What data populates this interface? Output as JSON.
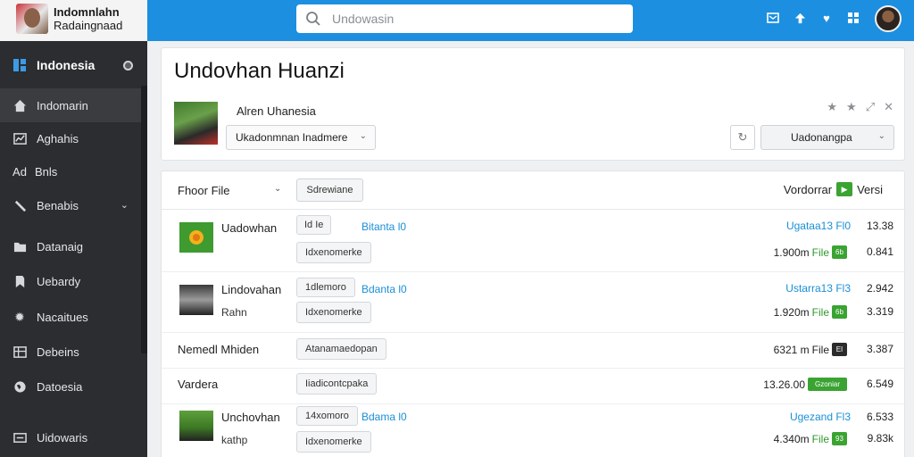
{
  "brand": {
    "line1": "Indomnlahn",
    "line2": "Radaingnaad"
  },
  "sidebar": {
    "header": "Indonesia",
    "items": [
      {
        "label": "Indomarin",
        "icon": "home-icon"
      },
      {
        "label": "Aghahis",
        "icon": "chart-icon"
      },
      {
        "label": "Bnls",
        "prefix": "Ad",
        "icon": "ad-icon"
      },
      {
        "label": "Benabis",
        "icon": "wrench-icon"
      },
      {
        "label": "Datanaig",
        "icon": "folder-icon"
      },
      {
        "label": "Uebardy",
        "icon": "bookmark-icon"
      },
      {
        "label": "Nacaitues",
        "icon": "gear-icon"
      },
      {
        "label": "Debeins",
        "icon": "table-icon"
      },
      {
        "label": "Datoesia",
        "icon": "globe-icon"
      },
      {
        "label": "Uidowaris",
        "icon": "list-icon"
      }
    ]
  },
  "search": {
    "placeholder": "Undowasin"
  },
  "header": {
    "title": "Undovhan Huanzi",
    "subtitle": "Alren Uhanesia",
    "dropdown": "Ukadonmnan Inadmere",
    "right_dropdown": "Uadonangpa"
  },
  "table": {
    "file_header": "Fhoor File",
    "filter_button": "Sdrewiane",
    "right_header": "Vordorrar",
    "right_header2": "Versi",
    "rows": [
      {
        "name": "Uadowhan",
        "name2": "",
        "tag": "Idxenomerke",
        "tag_top": "Id  Ie",
        "link": "Bitanta l0",
        "uline": "Ugataa13 Fl0",
        "uline_size": "13.38",
        "file_size": "1.900m",
        "file_type": "File",
        "badge": "6b",
        "size": "0.841"
      },
      {
        "name": "Lindovahan",
        "name2": "Rahn",
        "tag": "Idxenomerke",
        "tag_top": "1dlemoro",
        "link": "Bdanta l0",
        "uline": "Ustarra13 Fl3",
        "uline_size": "2.942",
        "file_size": "1.920m",
        "file_type": "File",
        "badge": "6b",
        "size": "3.319"
      },
      {
        "name": "Nemedl Mhiden",
        "name2": "",
        "tag": "Atanamaedopan",
        "tag_top": "",
        "link": "",
        "uline": "",
        "uline_size": "",
        "file_size": "6321 m",
        "file_type": "File",
        "badge": "EI",
        "size": "3.387"
      },
      {
        "name": "Vardera",
        "name2": "",
        "tag": "Iiadicontcpaka",
        "tag_top": "",
        "link": "",
        "uline": "",
        "uline_size": "",
        "file_size": "13.26.00",
        "file_type": "",
        "badge": "Gzoniar",
        "size": "6.549"
      },
      {
        "name": "Unchovhan",
        "name2": "kathp",
        "tag": "Idxenomerke",
        "tag_top": "14xomoro",
        "link": "Bdama l0",
        "uline": "Ugezand Fl3",
        "uline_size": "6.533",
        "file_size": "4.340m",
        "file_type": "File",
        "badge": "93",
        "size": "9.83k"
      }
    ]
  }
}
